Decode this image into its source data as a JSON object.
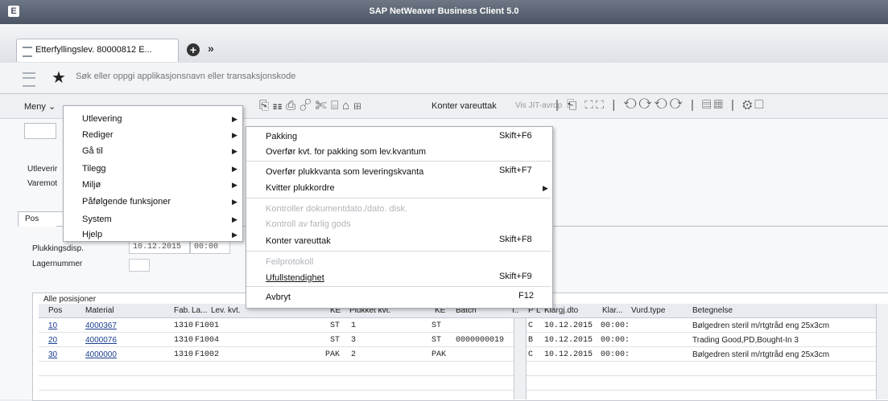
{
  "window": {
    "title": "SAP NetWeaver Business Client 5.0",
    "app_icon": "sap-logo-icon"
  },
  "tabs": {
    "active_label": "Etterfyllingslev. 80000812 E...",
    "new_tab_icon": "plus-circle-icon",
    "more_icon": "double-chevron-right-icon"
  },
  "search": {
    "placeholder": "Søk eller oppgi applikasjonsnavn eller transaksjonskode"
  },
  "toolbar": {
    "menu_label": "Meny ⌄",
    "konter_label": "Konter vareuttak",
    "vis_label": "Vis JIT-avrop"
  },
  "form": {
    "utlevering_label": "Utleverir",
    "varemot_label": "Varemot",
    "pos_tab": "Pos",
    "plukk_label": "Plukkingsdisp.",
    "plukk_date": "10.12.2015",
    "plukk_time": "00:00",
    "lager_label": "Lagernummer"
  },
  "menu": {
    "items": [
      {
        "label": "Utlevering"
      },
      {
        "label": "Rediger"
      },
      {
        "label": "Gå til"
      },
      {
        "label": "Tilegg"
      },
      {
        "label": "Miljø"
      },
      {
        "label": "Påfølgende funksjoner"
      },
      {
        "label": "System"
      },
      {
        "label": "Hjelp"
      }
    ]
  },
  "submenu": {
    "items": [
      {
        "label": "Pakking",
        "shortcut": "Skift+F6"
      },
      {
        "label": "Overfør kvt. for pakking som lev.kvantum",
        "shortcut": ""
      },
      {
        "label": "Overfør plukkvanta som leveringskvanta",
        "shortcut": "Skift+F7"
      },
      {
        "label": "Kvitter plukkordre",
        "shortcut": ""
      },
      {
        "label": "Kontroller dokumentdato./dato. disk.",
        "shortcut": ""
      },
      {
        "label": "Kontroll av farlig gods",
        "shortcut": ""
      },
      {
        "label": "Konter vareuttak",
        "shortcut": "Skift+F8"
      },
      {
        "label": "Feilprotokoll",
        "shortcut": ""
      },
      {
        "label": "Ufullstendighet",
        "shortcut": "Skift+F9"
      },
      {
        "label": "Avbryt",
        "shortcut": "F12"
      }
    ]
  },
  "table": {
    "title": "Alle posisjoner",
    "headers": {
      "pos": "Pos",
      "material": "Material",
      "fab": "Fab.",
      "la": "La...",
      "lev": "Lev. kvt.",
      "ke": "KE",
      "plukket": "Plukket kvt.",
      "ke2": "KE",
      "batch": "Batch",
      "i": "I..",
      "p": "P",
      "l": "L",
      "klargj": "Klargj.dto",
      "klar": "Klar...",
      "vurd": "Vurd.type",
      "beteg": "Betegnelse"
    },
    "rows": [
      {
        "pos": "10",
        "material": "4000367",
        "fab": "1310",
        "la": "F100",
        "lev": "1",
        "ke": "ST",
        "plukket": "1",
        "ke2": "ST",
        "batch": "",
        "l": "C",
        "klargj": "10.12.2015",
        "klar": "00:00:",
        "beteg": "Bølgedren steril m/rtgtråd eng 25x3cm"
      },
      {
        "pos": "20",
        "material": "4000076",
        "fab": "1310",
        "la": "F100",
        "lev": "4",
        "ke": "ST",
        "plukket": "3",
        "ke2": "ST",
        "batch": "0000000019",
        "l": "B",
        "klargj": "10.12.2015",
        "klar": "00:00:",
        "beteg": "Trading Good,PD,Bought-In 3"
      },
      {
        "pos": "30",
        "material": "4000000",
        "fab": "1310",
        "la": "F100",
        "lev": "2",
        "ke": "PAK",
        "plukket": "2",
        "ke2": "PAK",
        "batch": "",
        "l": "C",
        "klargj": "10.12.2015",
        "klar": "00:00:",
        "beteg": "Bølgedren steril m/rtgtråd eng 25x3cm"
      }
    ]
  }
}
